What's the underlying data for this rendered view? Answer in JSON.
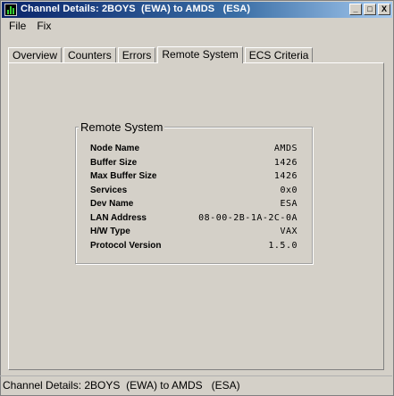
{
  "window": {
    "title": "Channel Details: 2BOYS  (EWA) to AMDS   (ESA)",
    "minimize": "_",
    "maximize": "□",
    "close": "X"
  },
  "menu": [
    "File",
    "Fix"
  ],
  "tabs": [
    {
      "label": "Overview",
      "active": false
    },
    {
      "label": "Counters",
      "active": false
    },
    {
      "label": "Errors",
      "active": false
    },
    {
      "label": "Remote System",
      "active": true
    },
    {
      "label": "ECS Criteria",
      "active": false
    }
  ],
  "remote_system": {
    "title": "Remote System",
    "rows": [
      {
        "label": "Node Name",
        "value": "AMDS"
      },
      {
        "label": "Buffer Size",
        "value": "1426"
      },
      {
        "label": "Max Buffer Size",
        "value": "1426"
      },
      {
        "label": "Services",
        "value": "0x0"
      },
      {
        "label": "Dev Name",
        "value": "ESA"
      },
      {
        "label": "LAN Address",
        "value": "08-00-2B-1A-2C-0A"
      },
      {
        "label": "H/W Type",
        "value": "VAX"
      },
      {
        "label": "Protocol Version",
        "value": "1.5.0"
      }
    ]
  },
  "status": "Channel Details: 2BOYS  (EWA) to AMDS   (ESA)"
}
